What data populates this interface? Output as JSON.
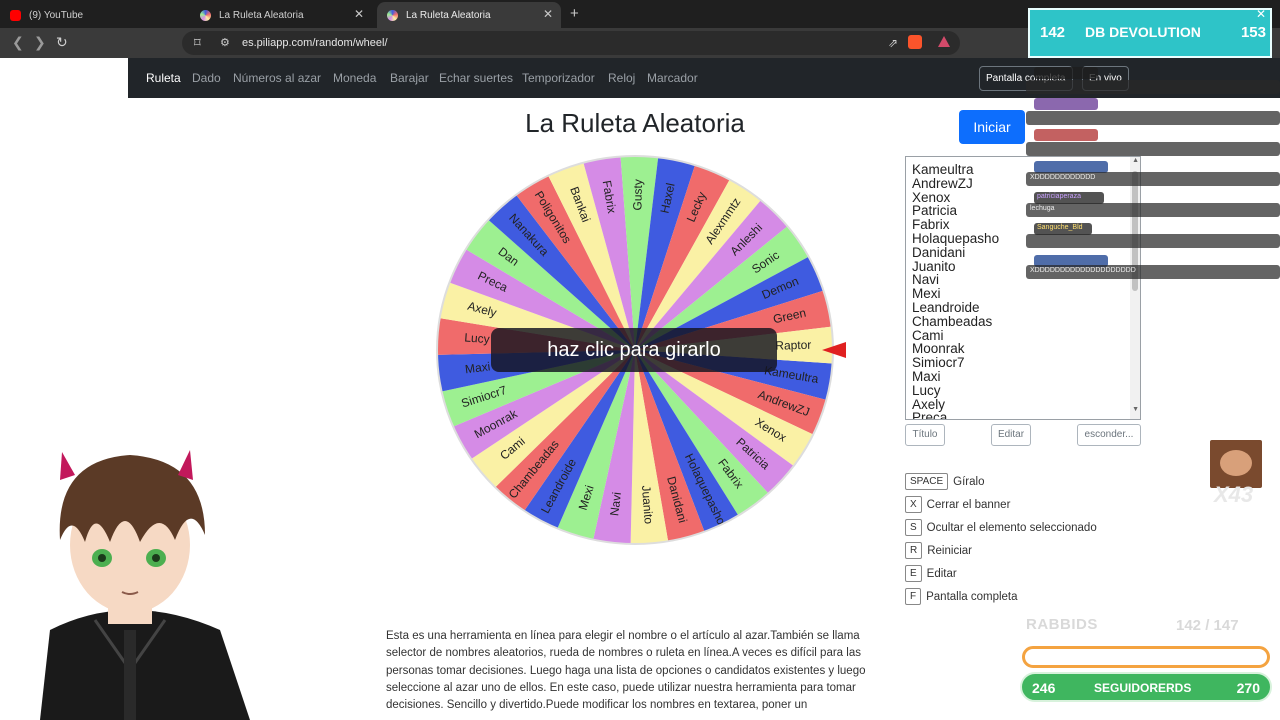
{
  "browser": {
    "tabs": [
      {
        "label": "(9) YouTube",
        "favicon_color": "#ff0000"
      },
      {
        "label": "La Ruleta Aleatoria",
        "favicon_color": "#c79ad9"
      },
      {
        "label": "La Ruleta Aleatoria",
        "favicon_color": "#c79ad9"
      }
    ],
    "url": "es.piliapp.com/random/wheel/"
  },
  "site_nav": {
    "items": [
      "Ruleta",
      "Dado",
      "Números al azar",
      "Moneda",
      "Barajar",
      "Echar suertes",
      "Temporizador",
      "Reloj",
      "Marcador"
    ],
    "fullscreen_label": "Pantalla completa",
    "live_label": "En vivo"
  },
  "page": {
    "title": "La Ruleta Aleatoria",
    "start_label": "Iniciar",
    "spin_hint": "haz clic para girarlo"
  },
  "wheel": {
    "names": [
      "Kameultra",
      "AndrewZJ",
      "Xenox",
      "Patricia",
      "Fabrix",
      "Holaquepasho",
      "Danidani",
      "Juanito",
      "Navi",
      "Mexi",
      "Leandroide",
      "Chambeadas",
      "Cami",
      "Moonrak",
      "Simiocr7",
      "Maxi",
      "Lucy",
      "Axely",
      "Preca",
      "Dan",
      "Nanakura",
      "Poligonitos",
      "Bankai",
      "Fabrix",
      "Gusty",
      "Haxel",
      "Lecky",
      "Alexmmtz",
      "Anleshi",
      "Sonic",
      "Demon",
      "Green",
      "Raptor"
    ],
    "colors": [
      "#3f5be0",
      "#f06b6b",
      "#faf1a5",
      "#d58be6",
      "#9df091"
    ]
  },
  "names_list": [
    "Kameultra",
    "AndrewZJ",
    "Xenox",
    "Patricia",
    "Fabrix",
    "Holaquepasho",
    "Danidani",
    "Juanito",
    "Navi",
    "Mexi",
    "Leandroide",
    "Chambeadas",
    "Cami",
    "Moonrak",
    "Simiocr7",
    "Maxi",
    "Lucy",
    "Axely",
    "Preca"
  ],
  "list_buttons": {
    "title": "Título",
    "edit": "Editar",
    "hide": "esconder..."
  },
  "shortcuts": [
    {
      "key": "SPACE",
      "label": "Gíralo"
    },
    {
      "key": "X",
      "label": "Cerrar el banner"
    },
    {
      "key": "S",
      "label": "Ocultar el elemento seleccionado"
    },
    {
      "key": "R",
      "label": "Reiniciar"
    },
    {
      "key": "E",
      "label": "Editar"
    },
    {
      "key": "F",
      "label": "Pantalla completa"
    }
  ],
  "description": "Esta es una herramienta en línea para elegir el nombre o el artículo al azar.También se llama selector de nombres aleatorios, rueda de nombres o ruleta en línea.A veces es difícil para las personas tomar decisiones. Luego haga una lista de opciones o candidatos existentes y luego seleccione al azar uno de ellos. En este caso, puede utilizar nuestra herramienta para tomar decisiones. Sencillo y divertido.Puede modificar los nombres en textarea, poner un",
  "overlay": {
    "top_left_num": "142",
    "top_title": "DB DEVOLUTION",
    "top_right_num": "153",
    "chat": [
      {
        "user": "",
        "msg": ""
      },
      {
        "user": "",
        "msg": ""
      },
      {
        "user": "",
        "msg": ""
      },
      {
        "user": "",
        "msg": "XDDDDDDDDDDDD"
      },
      {
        "user": "patriciaperaza",
        "msg": "lechuga"
      },
      {
        "user": "Sanguche_Bld",
        "msg": ""
      },
      {
        "user": "",
        "msg": "XDDDDDDDDDDDDDDDDDDDD"
      }
    ],
    "rabbids_label": "RABBIDS",
    "rabbids_count": "142 / 147",
    "followers_left": "246",
    "followers_label": "SEGUIDORERDS",
    "followers_right": "270",
    "emote_count": "X43"
  }
}
